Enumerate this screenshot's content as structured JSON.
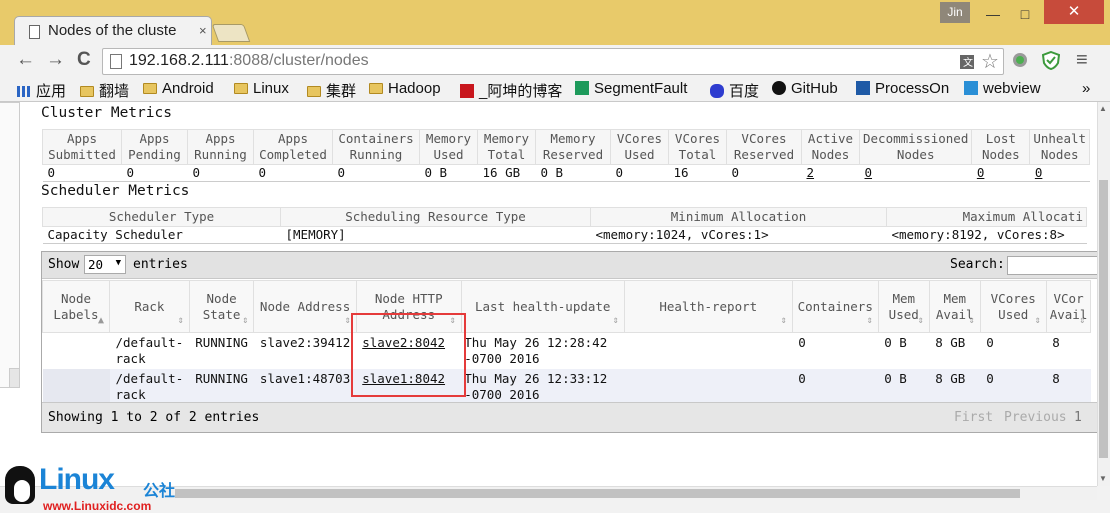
{
  "browser": {
    "tab_title": "Nodes of the cluste",
    "tab_close": "×",
    "user_label": "Jin",
    "win_min": "—",
    "win_max": "□",
    "win_close": "✕",
    "nav_back": "←",
    "nav_forward": "→",
    "nav_reload": "C",
    "url_host": "192.168.2.111",
    "url_rest": ":8088/cluster/nodes",
    "menu": "≡",
    "bookmarks": [
      {
        "label": "应用",
        "icon": "apps-grid-icon"
      },
      {
        "label": "翻墙",
        "icon": "folder-icon"
      },
      {
        "label": "Android",
        "icon": "folder-icon"
      },
      {
        "label": "Linux",
        "icon": "folder-icon"
      },
      {
        "label": "集群",
        "icon": "folder-icon"
      },
      {
        "label": "Hadoop",
        "icon": "folder-icon"
      },
      {
        "label": "_阿坤的博客",
        "icon": "csdn-icon"
      },
      {
        "label": "SegmentFault",
        "icon": "segmentfault-icon"
      },
      {
        "label": "百度",
        "icon": "baidu-icon"
      },
      {
        "label": "GitHub",
        "icon": "github-icon"
      },
      {
        "label": "ProcessOn",
        "icon": "processon-icon"
      },
      {
        "label": "webview",
        "icon": "webview-icon"
      }
    ],
    "bookmarks_more": "»"
  },
  "cluster_metrics": {
    "title": "Cluster Metrics",
    "headers": [
      [
        "Apps",
        "Submitted"
      ],
      [
        "Apps",
        "Pending"
      ],
      [
        "Apps",
        "Running"
      ],
      [
        "Apps",
        "Completed"
      ],
      [
        "Containers",
        "Running"
      ],
      [
        "Memory",
        "Used"
      ],
      [
        "Memory",
        "Total"
      ],
      [
        "Memory",
        "Reserved"
      ],
      [
        "VCores",
        "Used"
      ],
      [
        "VCores",
        "Total"
      ],
      [
        "VCores",
        "Reserved"
      ],
      [
        "Active",
        "Nodes"
      ],
      [
        "Decommissioned",
        "Nodes"
      ],
      [
        "Lost",
        "Nodes"
      ],
      [
        "Unhealt",
        "Nodes"
      ]
    ],
    "values": [
      "0",
      "0",
      "0",
      "0",
      "0",
      "0 B",
      "16 GB",
      "0 B",
      "0",
      "16",
      "0",
      "2",
      "0",
      "0",
      "0"
    ]
  },
  "scheduler_metrics": {
    "title": "Scheduler Metrics",
    "headers": [
      "Scheduler Type",
      "Scheduling Resource Type",
      "Minimum Allocation",
      "Maximum Allocati"
    ],
    "values": [
      "Capacity Scheduler",
      "[MEMORY]",
      "<memory:1024, vCores:1>",
      "<memory:8192, vCores:8>"
    ]
  },
  "nodes_table": {
    "show_label": "Show",
    "page_size": "20",
    "entries_label": "entries",
    "search_label": "Search:",
    "columns": [
      [
        "Node",
        "Labels"
      ],
      [
        "Rack"
      ],
      [
        "Node",
        "State"
      ],
      [
        "Node Address"
      ],
      [
        "Node HTTP",
        "Address"
      ],
      [
        "Last health-update"
      ],
      [
        "Health-report"
      ],
      [
        "Containers"
      ],
      [
        "Mem",
        "Used"
      ],
      [
        "Mem",
        "Avail"
      ],
      [
        "VCores",
        "Used"
      ],
      [
        "VCor",
        "Avail"
      ]
    ],
    "rows": [
      {
        "labels": "",
        "rack": [
          "/default-",
          "rack"
        ],
        "state": "RUNNING",
        "address": "slave2:39412",
        "http": "slave2:8042",
        "health_update": [
          "Thu May 26 12:28:42",
          "-0700 2016"
        ],
        "health_report": "",
        "containers": "0",
        "mem_used": "0 B",
        "mem_avail": "8 GB",
        "vcores_used": "0",
        "vcores_avail": "8"
      },
      {
        "labels": "",
        "rack": [
          "/default-",
          "rack"
        ],
        "state": "RUNNING",
        "address": "slave1:48703",
        "http": "slave1:8042",
        "health_update": [
          "Thu May 26 12:33:12",
          "-0700 2016"
        ],
        "health_report": "",
        "containers": "0",
        "mem_used": "0 B",
        "mem_avail": "8 GB",
        "vcores_used": "0",
        "vcores_avail": "8"
      }
    ],
    "footer_info": "Showing 1 to 2 of 2 entries",
    "pager_first": "First",
    "pager_previous": "Previous",
    "pager_page": "1"
  },
  "watermark": {
    "brand": "Linux",
    "brand_cn": "公社",
    "site": "www.Linuxidc.com"
  }
}
